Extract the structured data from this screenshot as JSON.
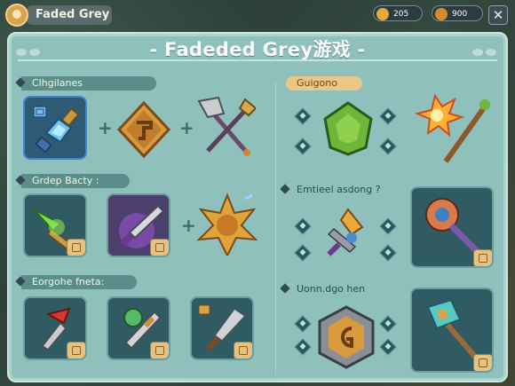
{
  "topbar": {
    "title": "Faded Grey",
    "gold_amount": "205",
    "coin_amount": "900"
  },
  "header": {
    "title": "- Fadeded Grey游戏 -"
  },
  "left": {
    "sections": [
      {
        "label": "Clhgilanes"
      },
      {
        "label": "Grdep Bacty :"
      },
      {
        "label": "Eorgohe fneta:"
      }
    ]
  },
  "right": {
    "sections": [
      {
        "label": "Guigono"
      },
      {
        "label": "Emtieel asdong ?"
      },
      {
        "label": "Uonn.dgo hen"
      }
    ]
  },
  "colors": {
    "panel": "#8fc0bb",
    "label_teal": "#5b8d8a",
    "label_gold": "#e9c784",
    "slot": "#315b63",
    "badge": "#e5c280"
  }
}
